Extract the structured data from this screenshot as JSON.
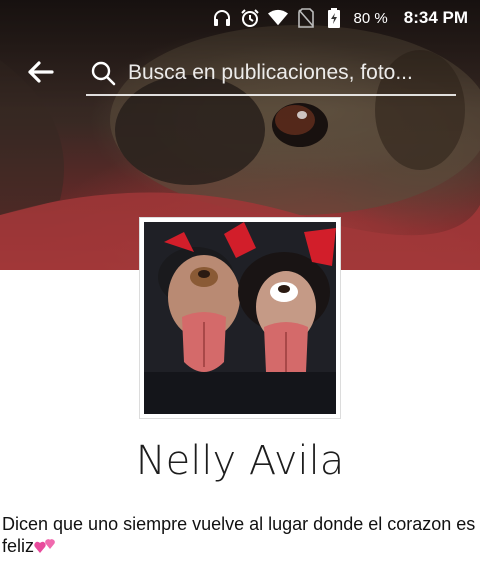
{
  "status_bar": {
    "battery_percent": "80 %",
    "time": "8:34 PM",
    "icons": [
      "headphones-icon",
      "alarm-icon",
      "wifi-icon",
      "no-sim-icon",
      "battery-charging-icon"
    ]
  },
  "search": {
    "placeholder": "Busca en publicaciones, foto..."
  },
  "profile": {
    "name": "Nelly Avila",
    "bio": "Dicen que uno siempre vuelve al lugar donde el corazon es feliz",
    "bio_emoji": "two-hearts-icon"
  },
  "colors": {
    "status_text": "#ffffff",
    "heart_pink": "#e84a9c"
  }
}
